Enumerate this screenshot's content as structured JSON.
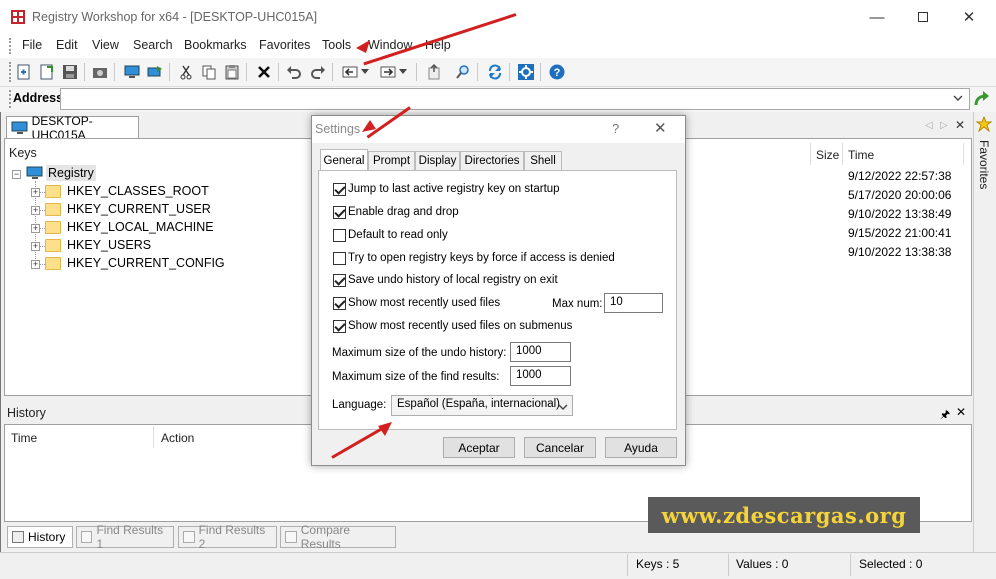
{
  "window": {
    "title": "Registry Workshop for x64 - [DESKTOP-UHC015A]"
  },
  "menu": [
    "File",
    "Edit",
    "View",
    "Search",
    "Bookmarks",
    "Favorites",
    "Tools",
    "Window",
    "Help"
  ],
  "address": {
    "label": "Address",
    "value": ""
  },
  "doc_tab": "DESKTOP-UHC015A",
  "keys_panel": {
    "header_keys": "Keys",
    "header_size": "Size",
    "header_time": "Time",
    "root": "Registry",
    "items": [
      {
        "label": "HKEY_CLASSES_ROOT",
        "time": "9/12/2022 22:57:38"
      },
      {
        "label": "HKEY_CURRENT_USER",
        "time": "5/17/2020 20:00:06"
      },
      {
        "label": "HKEY_LOCAL_MACHINE",
        "time": "9/10/2022 13:38:49"
      },
      {
        "label": "HKEY_USERS",
        "time": "9/15/2022 21:00:41"
      },
      {
        "label": "HKEY_CURRENT_CONFIG",
        "time": "9/10/2022 13:38:38"
      }
    ]
  },
  "favorites_label": "Favorites",
  "history_panel": {
    "title": "History",
    "col_time": "Time",
    "col_action": "Action"
  },
  "bottom_tabs": [
    "History",
    "Find Results 1",
    "Find Results 2",
    "Compare Results"
  ],
  "status": {
    "keys": "Keys : 5",
    "values": "Values : 0",
    "selected": "Selected : 0"
  },
  "settings": {
    "title": "Settings",
    "help": "?",
    "tabs": [
      "General",
      "Prompt",
      "Display",
      "Directories",
      "Shell"
    ],
    "options": [
      {
        "label": "Jump to last active registry key on startup",
        "checked": true
      },
      {
        "label": "Enable drag and drop",
        "checked": true
      },
      {
        "label": "Default to read only",
        "checked": false
      },
      {
        "label": "Try to open registry keys by force if access is denied",
        "checked": false
      },
      {
        "label": "Save undo history of local registry on exit",
        "checked": true
      },
      {
        "label": "Show most recently used files",
        "checked": true
      },
      {
        "label": "Show most recently used files on submenus",
        "checked": true
      }
    ],
    "max_num_label": "Max num:",
    "max_num_value": "10",
    "undo_label": "Maximum size of the undo history:",
    "undo_value": "1000",
    "find_label": "Maximum size of the find results:",
    "find_value": "1000",
    "language_label": "Language:",
    "language_value": "Español (España, internacional)",
    "buttons": {
      "ok": "Aceptar",
      "cancel": "Cancelar",
      "help": "Ayuda"
    }
  },
  "watermark": "www.zdescargas.org",
  "colors": {
    "arrow": "#d21f1f",
    "watermark_text": "#f5d33a",
    "watermark_bg": "#5a5a5a"
  }
}
